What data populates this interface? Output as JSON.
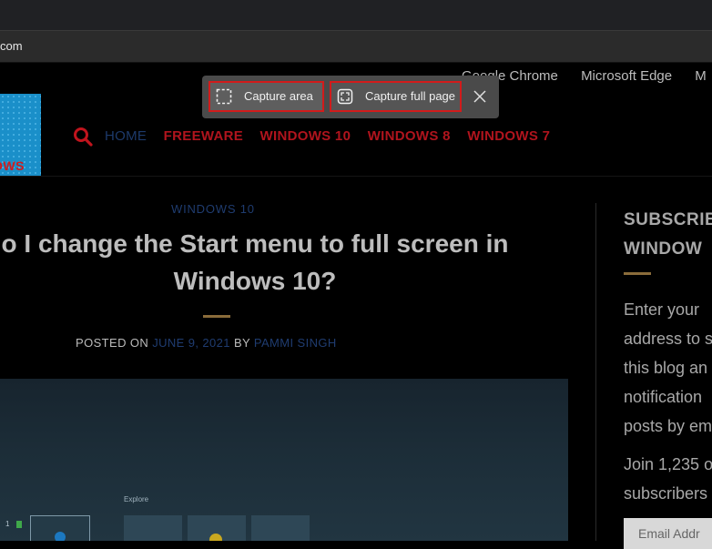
{
  "browser": {
    "address_text": "com"
  },
  "capture_toolbar": {
    "capture_area_label": "Capture area",
    "capture_full_page_label": "Capture full page"
  },
  "site": {
    "top_links": [
      "Google Chrome",
      "Microsoft Edge",
      "M"
    ],
    "logo_text": "OWS",
    "nav": [
      "HOME",
      "FREEWARE",
      "WINDOWS 10",
      "WINDOWS 8",
      "WINDOWS 7"
    ]
  },
  "article": {
    "category": "WINDOWS 10",
    "title_line1": "o I change the Start menu to full screen in",
    "title_line2": "Windows 10?",
    "meta_prefix": "POSTED ON",
    "date": "JUNE 9, 2021",
    "meta_by": "BY",
    "author": "PAMMI SINGH",
    "hero_explore": "Explore"
  },
  "sidebar": {
    "title_line1": "SUBSCRIBE",
    "title_line2": "WINDOW",
    "desc_lines": [
      "Enter your",
      "address to s",
      "this blog an",
      "notification",
      "posts by em"
    ],
    "join_lines": [
      "Join 1,235 o",
      "subscribers"
    ],
    "email_placeholder": "Email Addr"
  },
  "colors": {
    "accent_red": "#d21b1b",
    "nav_red": "#b0141d",
    "link_blue": "#1f3c70",
    "rule_gold": "#8a6c3a"
  }
}
